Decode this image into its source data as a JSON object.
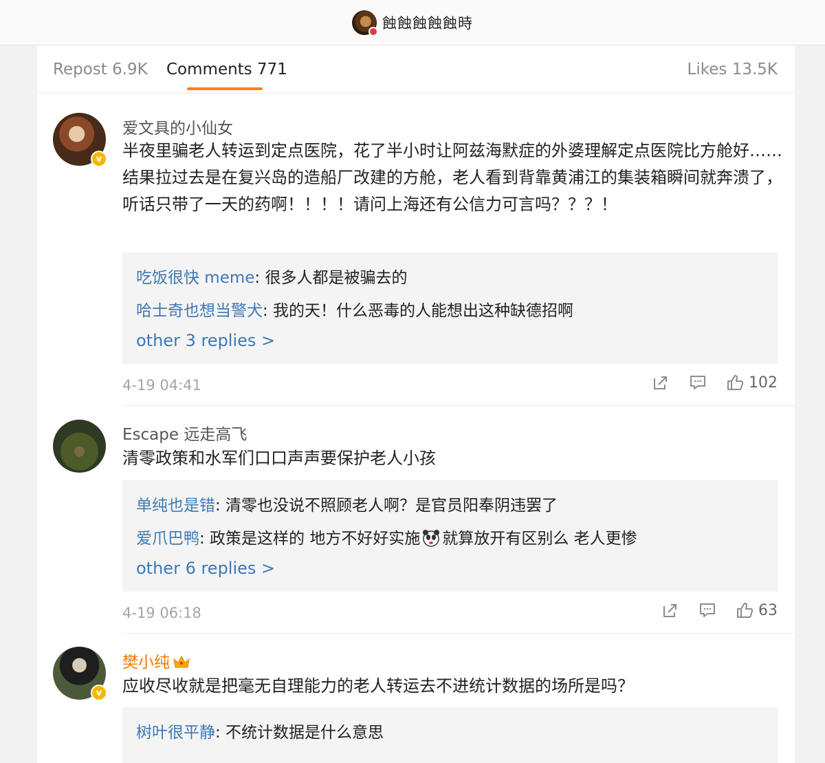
{
  "header": {
    "username": "蝕蝕蝕蝕蝕時",
    "icons": [
      "avatar",
      "red-badge-icon"
    ]
  },
  "tabs": {
    "repost": "Repost 6.9K",
    "comments": "Comments 771",
    "likes": "Likes 13.5K",
    "active_color": "#ff8200"
  },
  "comments": [
    {
      "user": "爱文具的小仙女",
      "text": "半夜里骗老人转运到定点医院，花了半小时让阿兹海默症的外婆理解定点医院比方舱好……结果拉过去是在复兴岛的造船厂改建的方舱，老人看到背靠黄浦江的集装箱瞬间就奔溃了，听话只带了一天的药啊！！！！请问上海还有公信力可言吗？？？！",
      "replies": [
        {
          "user": "吃饭很快 meme",
          "text": ": 很多人都是被骗去的"
        },
        {
          "user": "哈士奇也想当警犬",
          "text": ": 我的天！什么恶毒的人能想出这种缺德招啊"
        }
      ],
      "more": "other 3 replies >",
      "time": "4-19 04:41",
      "likes": "102"
    },
    {
      "user": "Escape 远走高飞",
      "text": "清零政策和水军们口口声声要保护老人小孩",
      "replies": [
        {
          "user": "单纯也是错",
          "text": ": 清零也没说不照顾老人啊？是官员阳奉阴违罢了"
        },
        {
          "user": "爱爪巴鸭",
          "text": ": 政策是这样的 地方不好好实施",
          "text2": "就算放开有区别么 老人更惨"
        }
      ],
      "more": "other 6 replies >",
      "time": "4-19 06:18",
      "likes": "63"
    },
    {
      "user": "樊小纯",
      "text": "应收尽收就是把毫无自理能力的老人转运去不进统计数据的场所是吗？",
      "replies": [
        {
          "user": "树叶很平静",
          "text": ": 不统计数据是什么意思"
        }
      ]
    }
  ],
  "colors": {
    "link_blue": "#3e79b5",
    "vip_orange": "#f47b00",
    "verified_badge": "#f5b800"
  }
}
